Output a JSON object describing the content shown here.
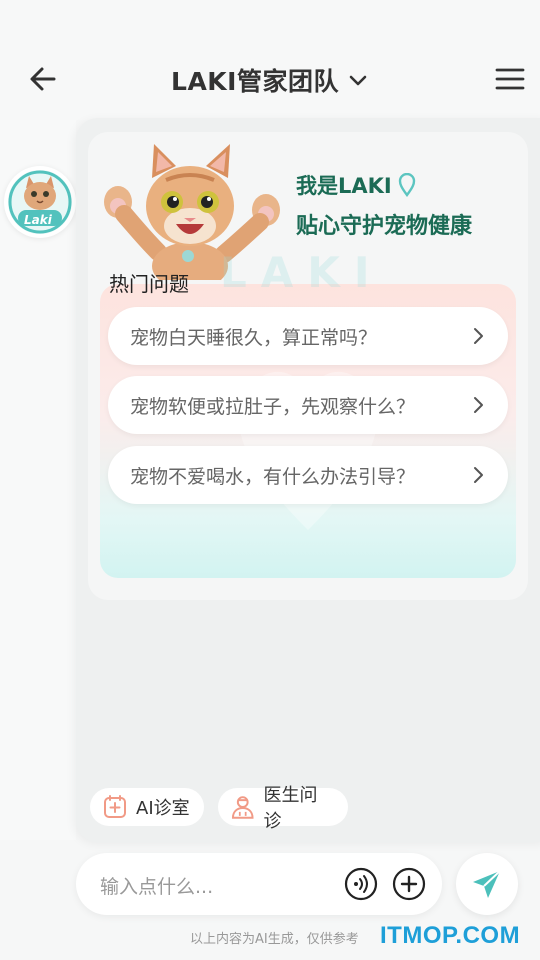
{
  "header": {
    "title": "LAKI管家团队",
    "back_icon": "arrow-left-icon",
    "dropdown_icon": "chevron-down-icon",
    "menu_icon": "hamburger-menu-icon"
  },
  "assistant": {
    "avatar_text": "Laki",
    "greeting_line1": "我是LAKI",
    "greeting_line2": "贴心守护宠物健康",
    "watermark": "LAKI"
  },
  "hot_questions": {
    "label": "热门问题",
    "items": [
      {
        "text": "宠物白天睡很久，算正常吗？"
      },
      {
        "text": "宠物软便或拉肚子，先观察什么？"
      },
      {
        "text": "宠物不爱喝水，有什么办法引导？"
      }
    ]
  },
  "quick_actions": [
    {
      "label": "AI诊室",
      "icon": "clinic-plus-icon"
    },
    {
      "label": "医生问诊",
      "icon": "doctor-icon"
    }
  ],
  "composer": {
    "placeholder": "输入点什么...",
    "voice_icon": "voice-icon",
    "plus_icon": "plus-circle-icon",
    "send_icon": "send-icon"
  },
  "footer": {
    "disclaimer": "以上内容为AI生成，仅供参考",
    "site_watermark": "ITMOP.COM"
  },
  "colors": {
    "brand_green": "#1b6b55",
    "teal": "#5cc5c0",
    "coral": "#f4a08e",
    "send_teal": "#4cc0bb"
  }
}
